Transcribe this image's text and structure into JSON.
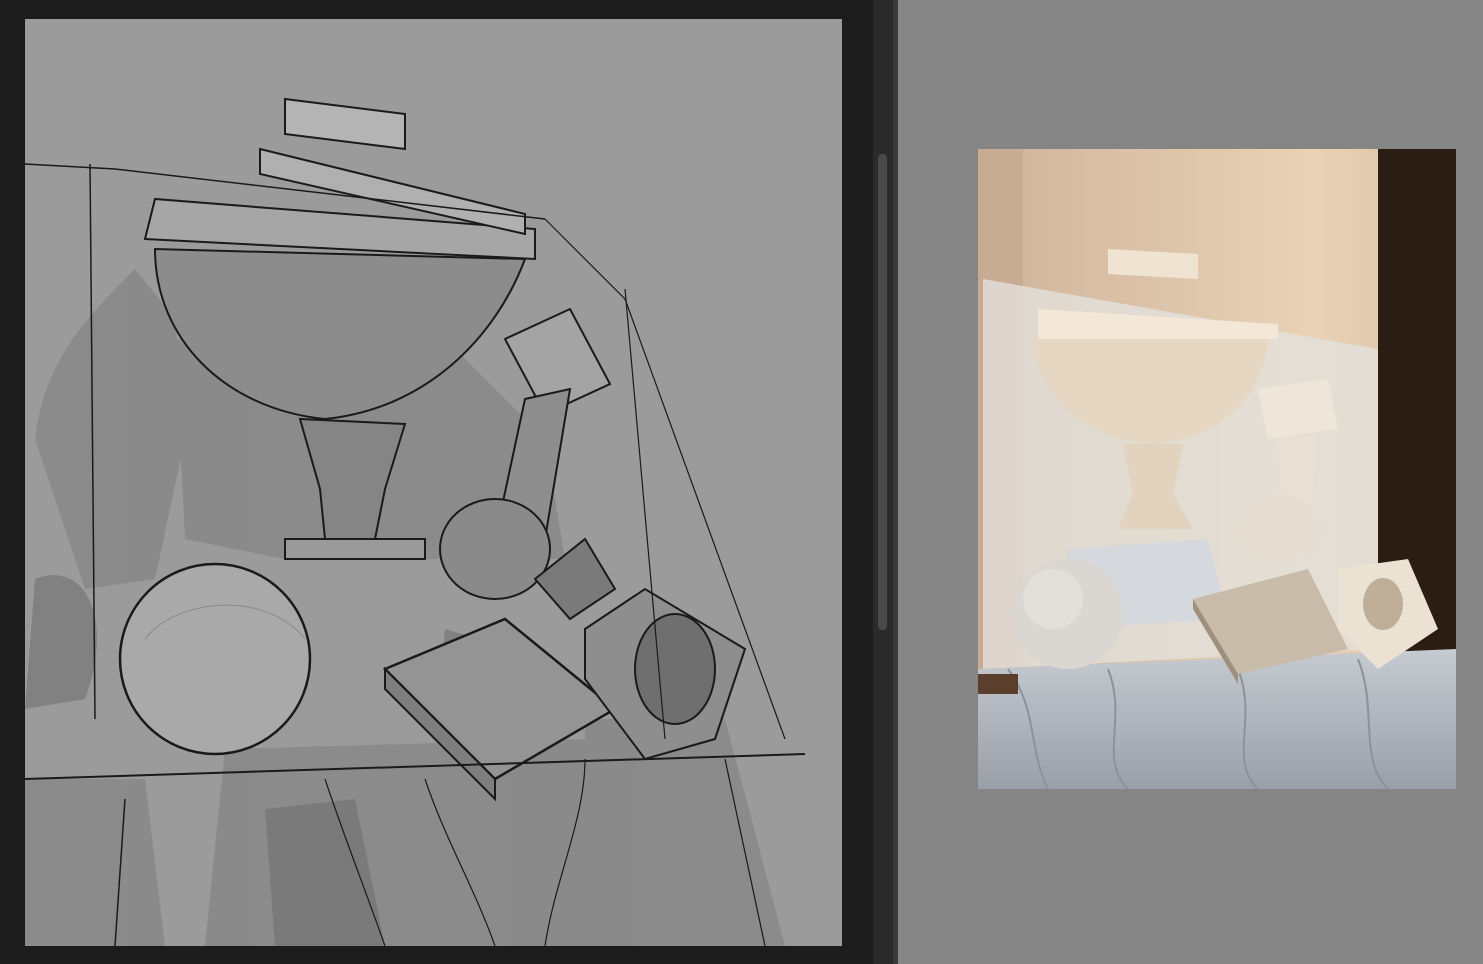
{
  "workspace": {
    "canvas_background": "#9b9b9b",
    "reference_background": "#858585",
    "panel_background": "#1c1c1c"
  },
  "canvas": {
    "subject": "sketch-canvas"
  },
  "reference": {
    "subject": "reference-photo"
  }
}
